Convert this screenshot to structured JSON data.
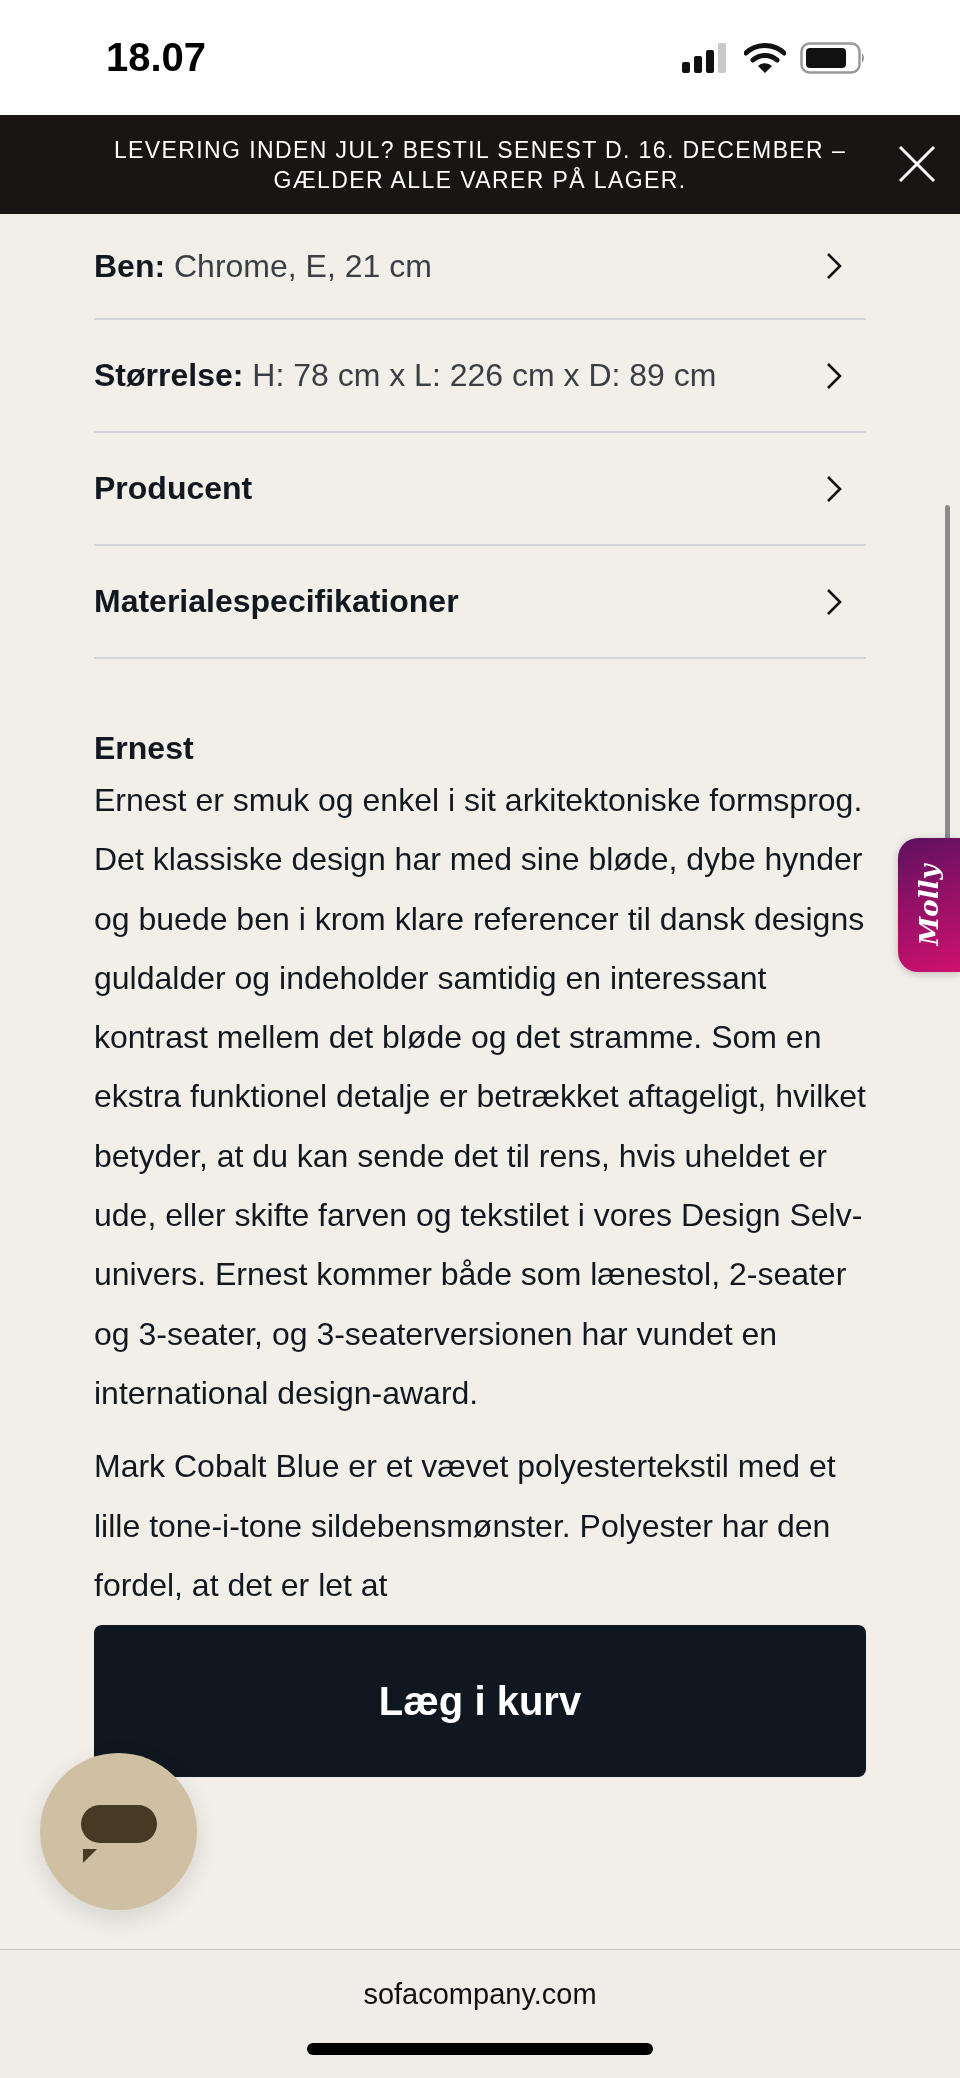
{
  "status_bar": {
    "time": "18.07"
  },
  "banner": {
    "text": "LEVERING INDEN JUL? BESTIL SENEST D. 16. DECEMBER – GÆLDER ALLE VARER PÅ LAGER."
  },
  "details": [
    {
      "text": "**Ben:** Chrome, E, 21 cm"
    },
    {
      "text": "**Størrelse:** H: 78 cm x L: 226 cm x D: 89 cm"
    },
    {
      "text": "**Producent**"
    },
    {
      "text": "**Materialespecifikationer**"
    }
  ],
  "description": {
    "heading": "Ernest",
    "paragraphs": [
      "Ernest er smuk og enkel i sit arkitektoniske formsprog. Det klassiske design har med sine bløde, dybe hynder og buede ben i krom klare referencer til dansk designs guldalder og indeholder samtidig en interessant kontrast mellem det bløde og det stramme. Som en ekstra funktionel detalje er betrækket aftageligt, hvilket betyder, at du kan sende det til rens, hvis uheldet er ude, eller skifte farven og tekstilet i vores Design Selv-univers. Ernest kommer både som lænestol, 2-seater og 3-seater, og 3-seaterversionen har vundet en international design-award.",
      "Mark Cobalt Blue er et vævet polyestertekstil med et lille tone-i-tone sildebensmønster. Polyester har den fordel, at det er let at"
    ]
  },
  "add_to_cart": "Læg i kurv",
  "side_tab": "Molly",
  "url": "sofacompany.com"
}
